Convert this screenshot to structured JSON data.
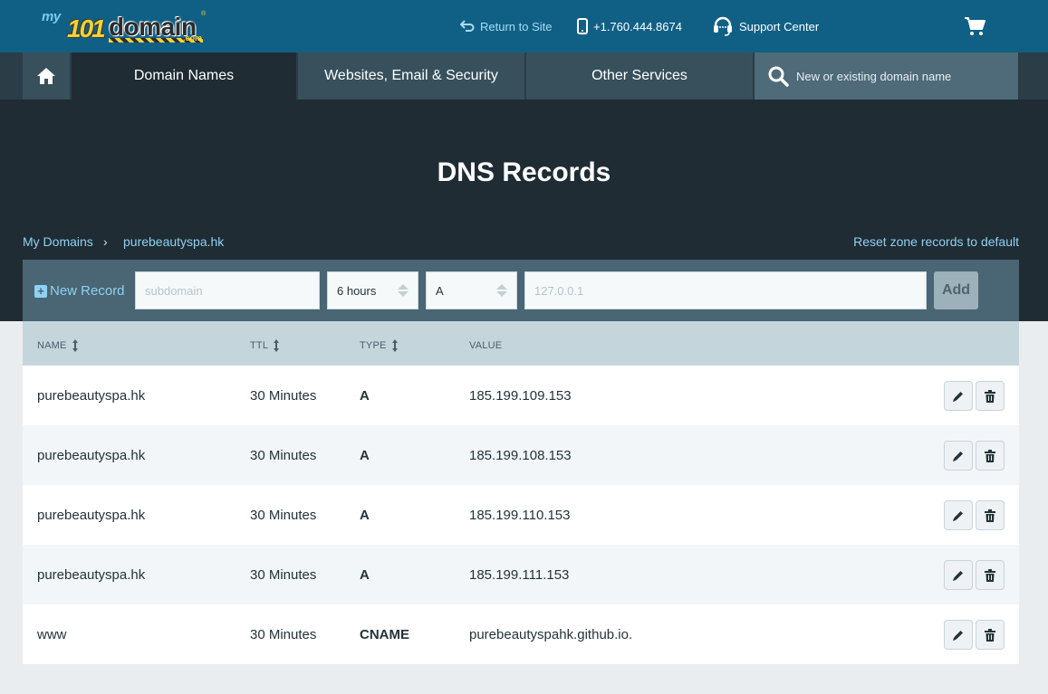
{
  "brand": {
    "my": "my",
    "num": "101",
    "domain": "domain",
    "com": ".com",
    "reg": "®"
  },
  "topbar": {
    "return_label": "Return to Site",
    "phone_label": "+1.760.444.8674",
    "support_label": "Support Center"
  },
  "nav": {
    "items": [
      {
        "label": "Domain Names",
        "active": true
      },
      {
        "label": "Websites, Email & Security"
      },
      {
        "label": "Other Services"
      }
    ],
    "search_placeholder": "New or existing domain name"
  },
  "page": {
    "title": "DNS Records",
    "breadcrumb": [
      "My Domains",
      "purebeautyspa.hk"
    ],
    "breadcrumb_sep": "›",
    "reset_label": "Reset zone records to default"
  },
  "new_record": {
    "label": "New Record",
    "subdomain_placeholder": "subdomain",
    "ttl_value": "6 hours",
    "type_value": "A",
    "value_placeholder": "127.0.0.1",
    "add_label": "Add"
  },
  "table": {
    "columns": [
      "NAME",
      "TTL",
      "TYPE",
      "VALUE"
    ],
    "rows": [
      {
        "name": "purebeautyspa.hk",
        "ttl": "30 Minutes",
        "type": "A",
        "value": "185.199.109.153"
      },
      {
        "name": "purebeautyspa.hk",
        "ttl": "30 Minutes",
        "type": "A",
        "value": "185.199.108.153"
      },
      {
        "name": "purebeautyspa.hk",
        "ttl": "30 Minutes",
        "type": "A",
        "value": "185.199.110.153"
      },
      {
        "name": "purebeautyspa.hk",
        "ttl": "30 Minutes",
        "type": "A",
        "value": "185.199.111.153"
      },
      {
        "name": "www",
        "ttl": "30 Minutes",
        "type": "CNAME",
        "value": "purebeautyspahk.github.io."
      }
    ]
  },
  "colors": {
    "topbar": "#106086",
    "hero": "#1f2c33",
    "link": "#8fd1f2",
    "table_header": "#c5d5dc"
  },
  "icons": [
    "home-icon",
    "return-icon",
    "phone-icon",
    "headset-icon",
    "cart-icon",
    "search-icon",
    "plus-icon",
    "sort-icon",
    "pencil-icon",
    "trash-icon"
  ]
}
